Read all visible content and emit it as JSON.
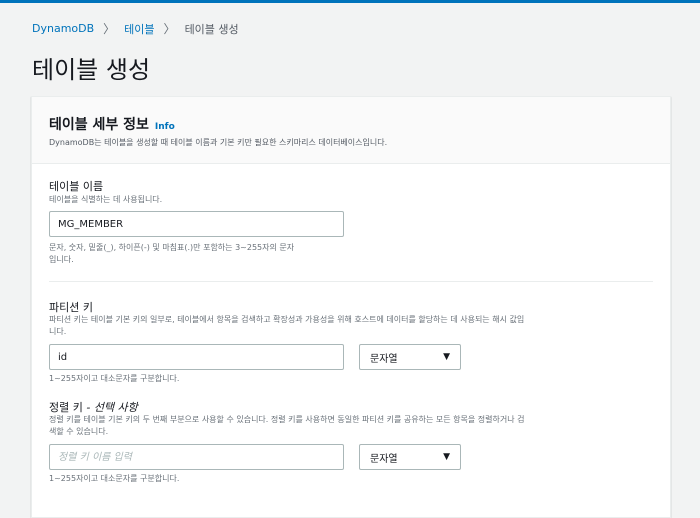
{
  "breadcrumb": {
    "root": "DynamoDB",
    "section": "테이블",
    "current": "테이블 생성"
  },
  "page_title": "테이블 생성",
  "card": {
    "title": "테이블 세부 정보",
    "info": "Info",
    "description": "DynamoDB는 테이블을 생성할 때 테이블 이름과 기본 키만 필요한 스키마리스 데이터베이스입니다."
  },
  "table_name": {
    "label": "테이블 이름",
    "description": "테이블을 식별하는 데 사용됩니다.",
    "value": "MG_MEMBER",
    "constraint_line1": "문자, 숫자, 밑줄(_), 하이픈(-) 및 마침표(.)만 포함하는 3~255자의 문자",
    "constraint_line2": "입니다."
  },
  "partition_key": {
    "label": "파티션 키",
    "description_line1": "파티션 키는 테이블 기본 키의 일부로, 테이블에서 항목을 검색하고 확장성과 가용성을 위해 호스트에 데이터를 할당하는 데 사용되는 해시 값입",
    "description_line2": "니다.",
    "value": "id",
    "type": "문자열",
    "hint": "1~255자이고 대소문자를 구분합니다."
  },
  "sort_key": {
    "label": "정렬 키",
    "optional": "- 선택 사항",
    "description_line1": "정렬 키를 테이블 기본 키의 두 번째 부분으로 사용할 수 있습니다. 정렬 키를 사용하면 동일한 파티션 키를 공유하는 모든 항목을 정렬하거나 검",
    "description_line2": "색할 수 있습니다.",
    "placeholder": "정렬 키 이름 입력",
    "type": "문자열",
    "hint": "1~255자이고 대소문자를 구분합니다."
  },
  "colors": {
    "accent": "#0073bb",
    "border": "#aab7b8",
    "background": "#f2f3f3"
  },
  "icons": {
    "separator": "chevron-right-icon",
    "dropdown": "caret-down-icon"
  }
}
